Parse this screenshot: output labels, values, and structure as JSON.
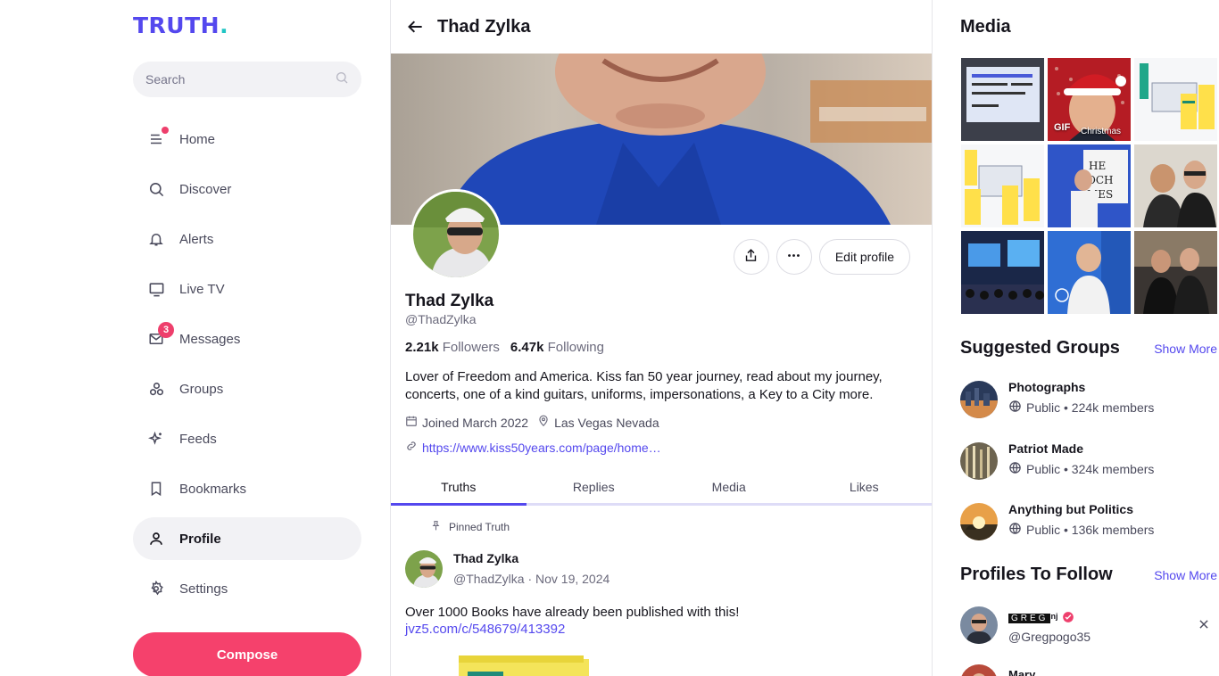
{
  "brand": {
    "logo": "TRUTH",
    "logo_dot": "."
  },
  "search": {
    "placeholder": "Search"
  },
  "nav": {
    "home": "Home",
    "discover": "Discover",
    "alerts": "Alerts",
    "live_tv": "Live TV",
    "messages": "Messages",
    "messages_badge": "3",
    "groups": "Groups",
    "feeds": "Feeds",
    "bookmarks": "Bookmarks",
    "profile": "Profile",
    "settings": "Settings"
  },
  "compose_label": "Compose",
  "header": {
    "title": "Thad Zylka"
  },
  "profile": {
    "name": "Thad Zylka",
    "handle": "@ThadZylka",
    "followers_count": "2.21k",
    "followers_label": "Followers",
    "following_count": "6.47k",
    "following_label": "Following",
    "bio": "Lover of Freedom and America. Kiss fan 50 year journey, read about my journey, concerts, one of a kind guitars, uniforms, impersonations, a Key to a City more.",
    "joined": "Joined March 2022",
    "location": "Las Vegas Nevada",
    "website": "https://www.kiss50years.com/page/home…",
    "edit_label": "Edit profile"
  },
  "tabs": [
    "Truths",
    "Replies",
    "Media",
    "Likes"
  ],
  "post": {
    "pinned_label": "Pinned Truth",
    "author": "Thad Zylka",
    "meta": "@ThadZylka · Nov 19, 2024",
    "text": "Over 1000 Books have already been published with this!",
    "link": "jvz5.com/c/548679/413392"
  },
  "right": {
    "media_title": "Media",
    "gif_label": "GIF",
    "gif_caption": "Christmas",
    "groups_title": "Suggested Groups",
    "show_more": "Show More",
    "groups": [
      {
        "name": "Photographs",
        "meta": "Public • 224k members"
      },
      {
        "name": "Patriot Made",
        "meta": "Public • 324k members"
      },
      {
        "name": "Anything but Politics",
        "meta": "Public • 136k members"
      }
    ],
    "profiles_title": "Profiles To Follow",
    "follow": {
      "name_badge": "GREG",
      "name_suffix": "nj",
      "handle": "@Gregpogo35",
      "next_name": "Mary"
    }
  },
  "colors": {
    "brand": "#5448ee",
    "accent_teal": "#20c5c4",
    "compose": "#f5416c",
    "badge": "#ee3f6c"
  }
}
